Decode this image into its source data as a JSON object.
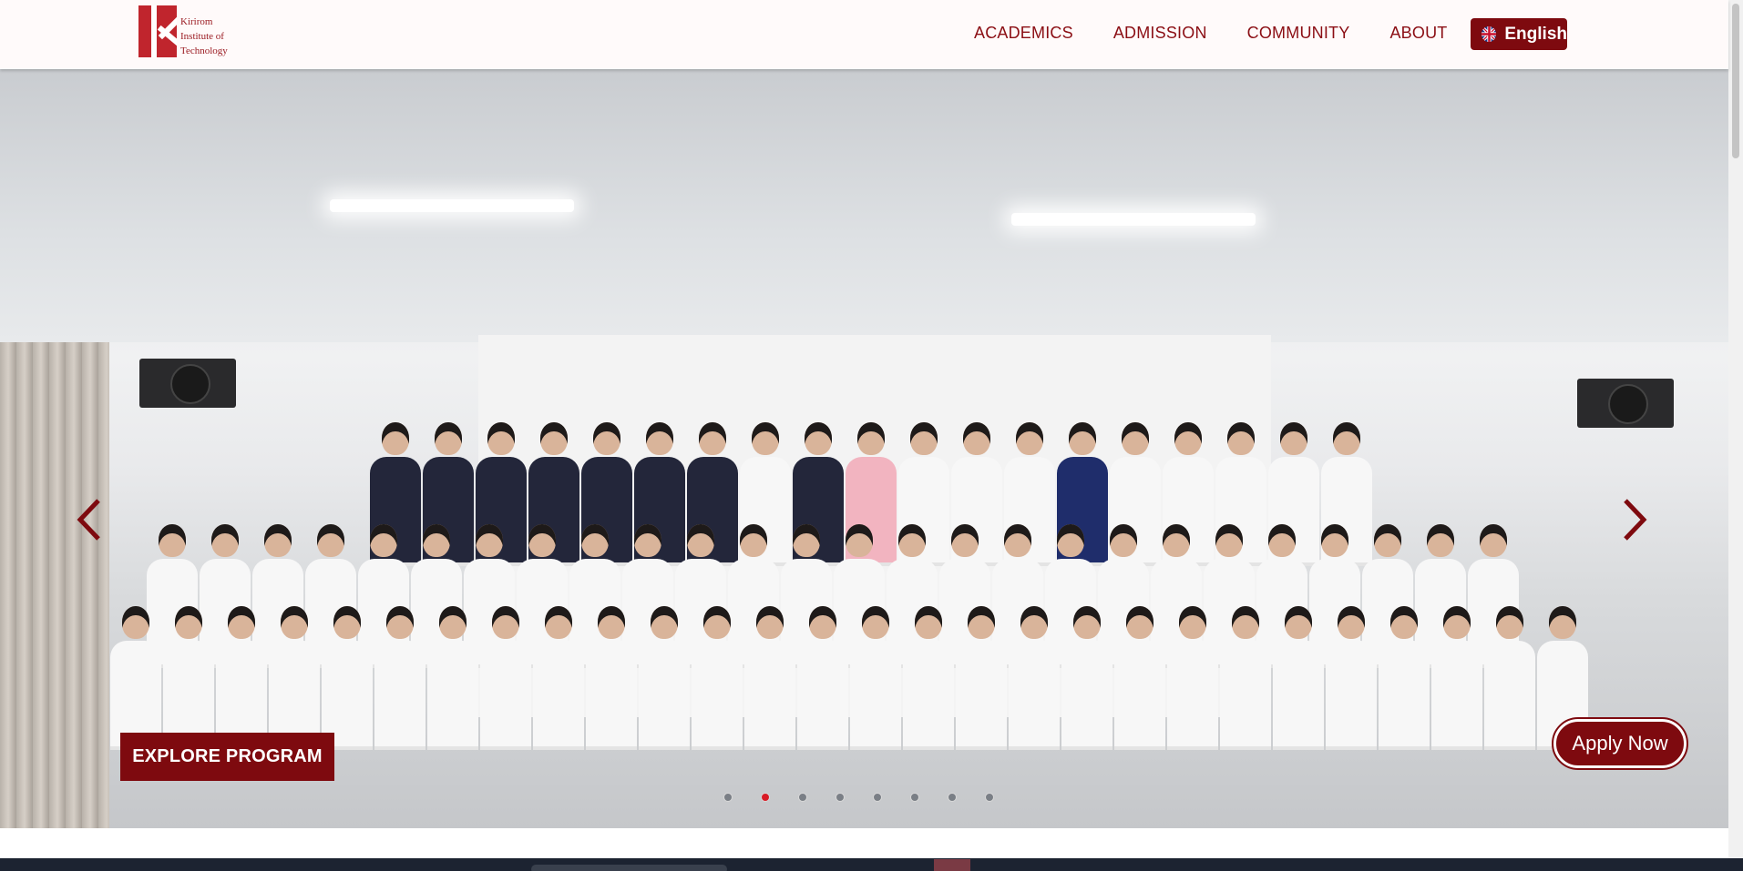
{
  "header": {
    "logo": {
      "line1": "Kirirom",
      "line2": "Institute of",
      "line3": "Technology"
    },
    "nav": [
      {
        "label": "ACADEMICS"
      },
      {
        "label": "ADMISSION"
      },
      {
        "label": "COMMUNITY"
      },
      {
        "label": "ABOUT"
      }
    ],
    "language": {
      "label": "English",
      "icon": "uk-flag-icon"
    }
  },
  "hero": {
    "image_alt": "group photo",
    "explore_label": "EXPLORE PROGRAM",
    "apply_label": "Apply Now",
    "slides_total": 8,
    "active_slide": 2
  },
  "colors": {
    "brand": "#7e0a0f",
    "nav_text": "#8b0e14",
    "active_dot": "#d81b26"
  }
}
